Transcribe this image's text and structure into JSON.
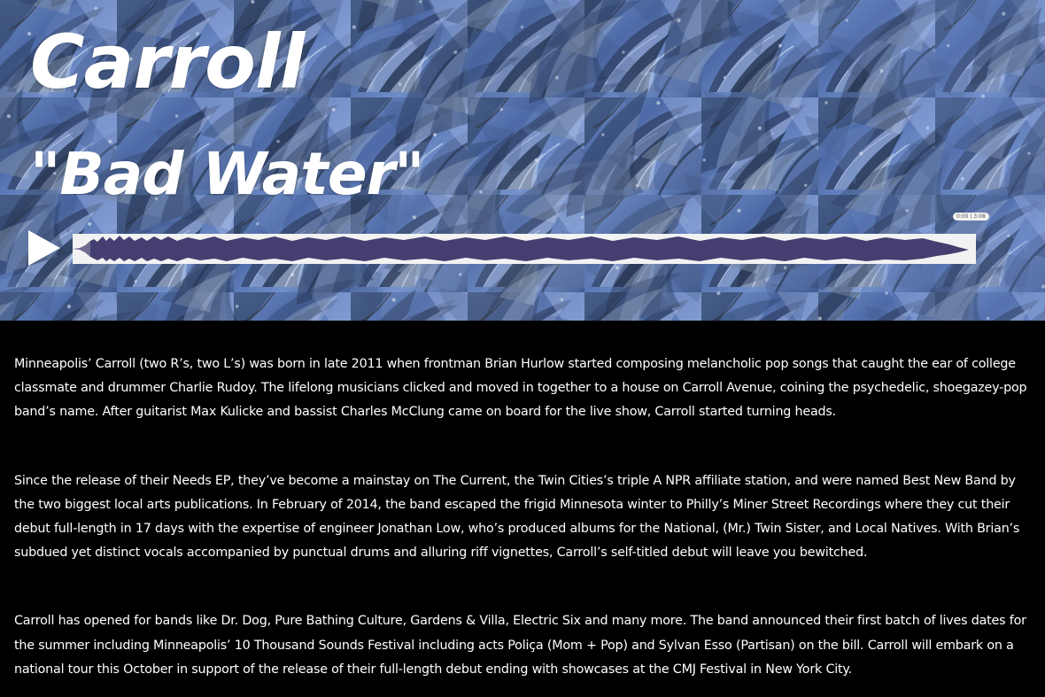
{
  "header": {
    "artist": "Carroll",
    "track_title": "\"Bad Water\""
  },
  "player": {
    "time_display": "0:00 | 3:08",
    "progress": 0,
    "play_icon": "play-icon",
    "waveform_color": "#443f70",
    "waveform_background": "#f2f2f2"
  },
  "colors": {
    "background": "#000000",
    "text": "#ffffff",
    "marble_blue": "#5f7fbd",
    "marble_dark": "#233047"
  },
  "article": {
    "paragraphs": [
      "Minneapolis’ Carroll (two R’s, two L’s) was born in late 2011 when frontman Brian Hurlow started composing melancholic pop songs that caught the ear of college classmate and drummer Charlie Rudoy. The lifelong musicians clicked and moved in together to a house on Carroll Avenue, coining the psychedelic, shoegazey-pop band’s name. After guitarist Max Kulicke and bassist Charles McClung came on board for the live show, Carroll started turning heads.",
      "Since the release of their Needs EP, they’ve become a mainstay on The Current, the Twin Cities’s triple A NPR affiliate station, and were named Best New Band by the two biggest local arts publications. In February of 2014, the band escaped the frigid Minnesota winter to Philly’s Miner Street Recordings where they cut their debut full-length in 17 days with the expertise of engineer Jonathan Low, who’s produced albums for the National, (Mr.) Twin Sister, and Local Natives. With Brian’s subdued yet distinct vocals accompanied by punctual drums and alluring riff vignettes, Carroll’s self-titled debut will leave you bewitched.",
      "Carroll has opened for bands like Dr. Dog, Pure Bathing Culture, Gardens & Villa, Electric Six and many more. The band announced their first batch of lives dates for the summer including Minneapolis’ 10 Thousand Sounds Festival including acts Poliça (Mom + Pop) and Sylvan Esso (Partisan) on the bill. Carroll will embark on a national tour this October in support of the release of their full-length debut ending with showcases at the CMJ Festival in New York City."
    ]
  }
}
